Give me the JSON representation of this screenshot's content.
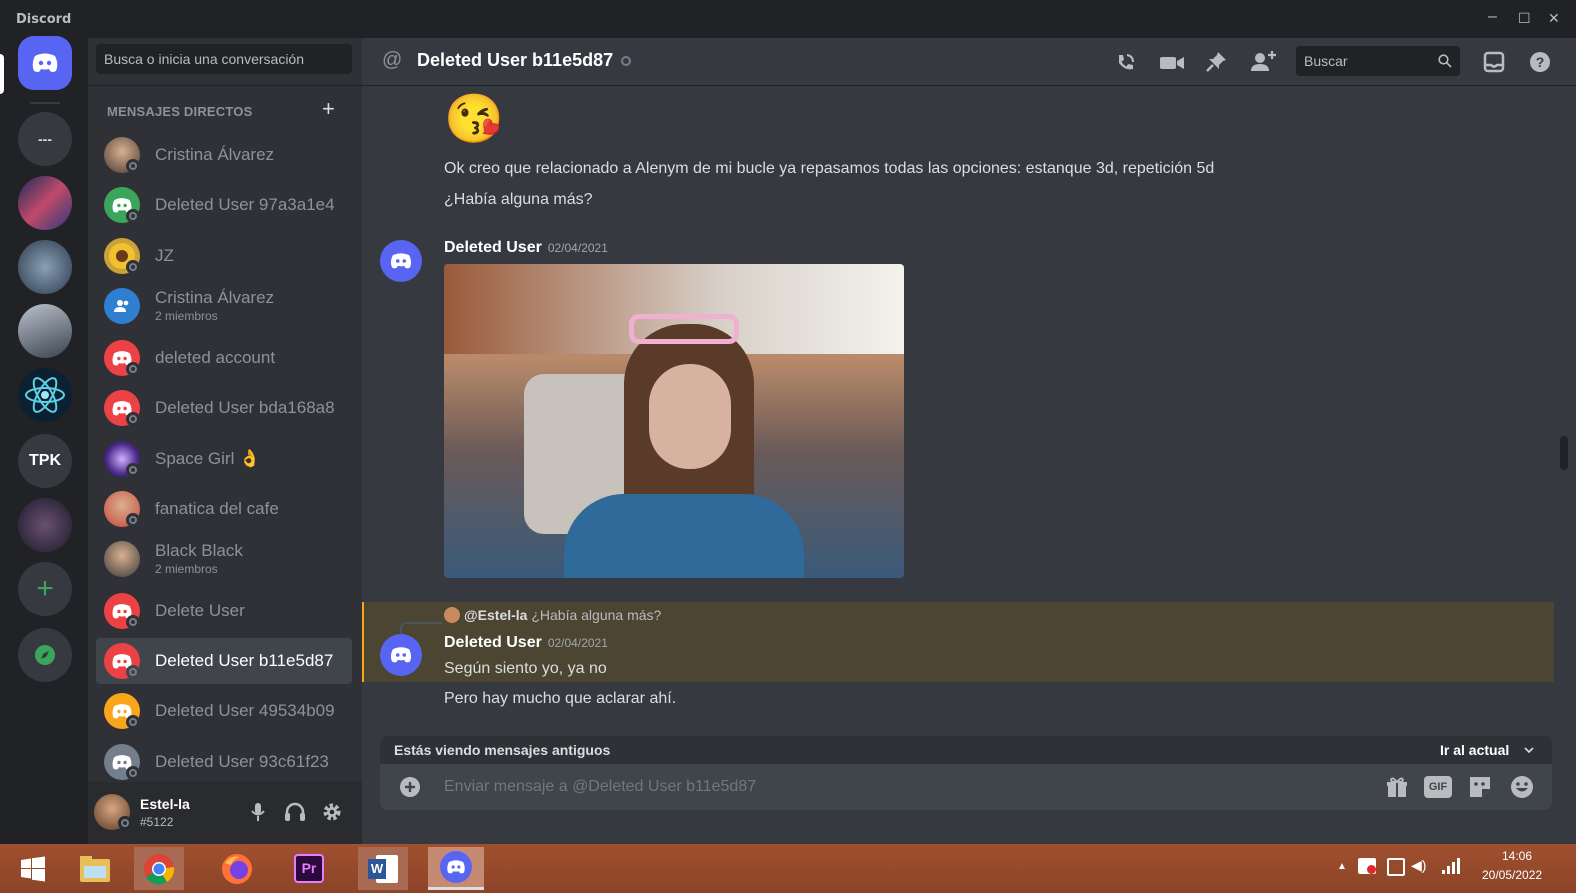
{
  "app": {
    "title": "Discord"
  },
  "window_controls": {
    "min": "–",
    "max": "☐",
    "close": "✕"
  },
  "guilds": {
    "home_icon": "discord-logo-icon",
    "dm_placeholder": "---",
    "tpk_label": "TPK",
    "add_icon": "plus-icon",
    "explore_icon": "compass-icon"
  },
  "dm_panel": {
    "search_placeholder": "Busca o inicia una conversación",
    "header": "MENSAJES DIRECTOS",
    "add_icon": "plus-icon",
    "items": [
      {
        "name": "Cristina Álvarez",
        "sub": "",
        "avatar": "photo",
        "color": "#4a3b32"
      },
      {
        "name": "Deleted User 97a3a1e4",
        "sub": "",
        "avatar": "discord",
        "color": "#3ba55c"
      },
      {
        "name": "JZ",
        "sub": "",
        "avatar": "flower",
        "color": "#c9a23a"
      },
      {
        "name": "Cristina Álvarez",
        "sub": "2 miembros",
        "avatar": "group",
        "color": "#2f7fd1"
      },
      {
        "name": "deleted account",
        "sub": "",
        "avatar": "discord",
        "color": "#ed4245"
      },
      {
        "name": "Deleted User bda168a8",
        "sub": "",
        "avatar": "discord",
        "color": "#ed4245"
      },
      {
        "name": "Space Girl 👌",
        "sub": "",
        "avatar": "space",
        "color": "#6a4fb0"
      },
      {
        "name": "fanatica del cafe",
        "sub": "",
        "avatar": "photo",
        "color": "#c9483b"
      },
      {
        "name": "Black Black",
        "sub": "2 miembros",
        "avatar": "photo",
        "color": "#3a3a3a"
      },
      {
        "name": "Delete User",
        "sub": "",
        "avatar": "discord",
        "color": "#ed4245"
      },
      {
        "name": "Deleted User b11e5d87",
        "sub": "",
        "avatar": "discord",
        "color": "#ed4245",
        "selected": true
      },
      {
        "name": "Deleted User 49534b09",
        "sub": "",
        "avatar": "discord",
        "color": "#faa61a"
      },
      {
        "name": "Deleted User 93c61f23",
        "sub": "",
        "avatar": "discord",
        "color": "#747f8d"
      }
    ]
  },
  "user_panel": {
    "name": "Estel-la",
    "tag": "#5122",
    "icons": [
      "microphone-icon",
      "headphones-icon",
      "gear-icon"
    ]
  },
  "chat": {
    "header_at": "@",
    "header_title": "Deleted User b11e5d87",
    "search_placeholder": "Buscar",
    "toolbar_icons": [
      "call-icon",
      "video-icon",
      "pin-icon",
      "add-member-icon",
      "inbox-icon",
      "help-icon"
    ],
    "messages": {
      "emoji": "😘",
      "line1": "Ok creo que relacionado a Alenym de mi bucle ya repasamos todas las opciones: estanque 3d, repetición 5d",
      "line2": "¿Había alguna más?",
      "msg2_author": "Deleted User",
      "msg2_ts": "02/04/2021",
      "reply_ref_name": "@Estel-la",
      "reply_ref_text": "¿Había alguna más?",
      "msg3_author": "Deleted User",
      "msg3_ts": "02/04/2021",
      "msg3_line1": "Según siento yo, ya no",
      "msg3_line2": "Pero hay mucho que aclarar ahí."
    },
    "old_banner": {
      "text": "Estás viendo mensajes antiguos",
      "jump": "Ir al actual"
    },
    "composer_placeholder": "Enviar mensaje a @Deleted User b11e5d87",
    "composer_icons": [
      "gift-icon",
      "gif-icon",
      "sticker-icon",
      "emoji-icon"
    ],
    "gif_label": "GIF"
  },
  "taskbar": {
    "apps": [
      "windows-start-icon",
      "file-explorer-icon",
      "chrome-icon",
      "firefox-icon",
      "premiere-icon",
      "word-icon",
      "discord-icon"
    ],
    "premiere_label": "Pr",
    "word_label": "W",
    "time": "14:06",
    "date": "20/05/2022",
    "tray_arrow": "▲"
  }
}
